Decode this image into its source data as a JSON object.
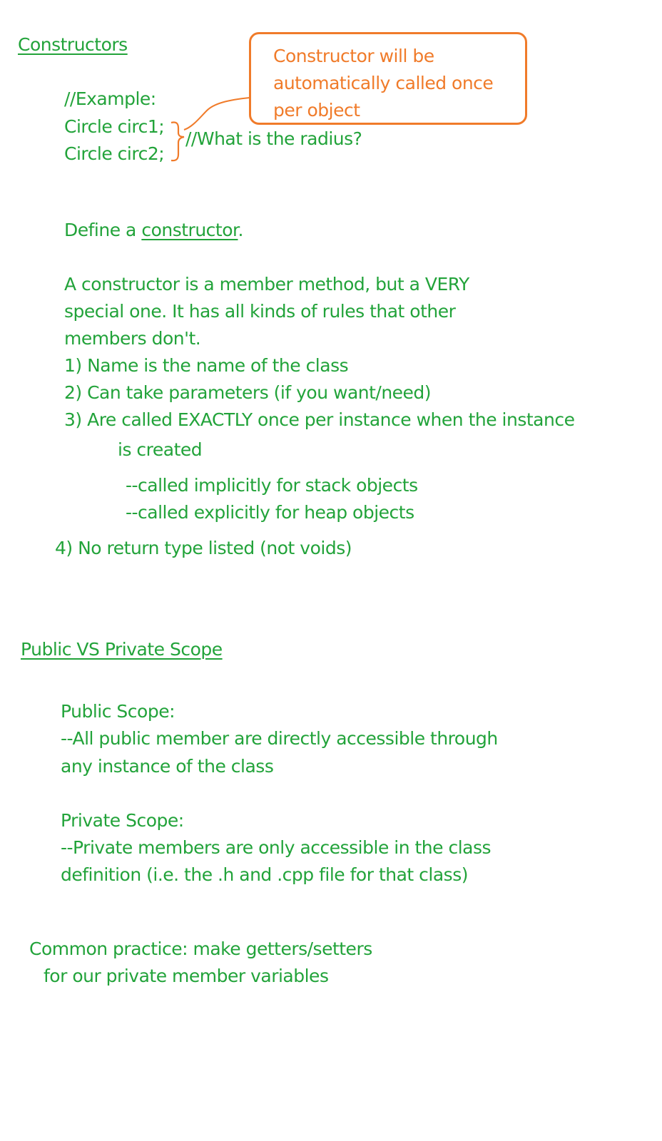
{
  "section1": {
    "heading": "Constructors",
    "example_comment": "//Example:",
    "code_line1": "Circle circ1;",
    "code_line2": "Circle circ2;",
    "radius_comment": "//What is the radius?",
    "callout_lines": [
      "Constructor will be",
      "automatically called once",
      "per object"
    ],
    "define_prefix": "Define a ",
    "define_link": "constructor",
    "define_suffix": ".",
    "para_lines": [
      "A constructor is a member method, but a VERY",
      "special one. It has all kinds of rules that other",
      "members don't."
    ],
    "rule1": "1) Name is the name of the class",
    "rule2": "2) Can take parameters (if you want/need)",
    "rule3_line1": "3) Are called EXACTLY once per instance when the instance",
    "rule3_line2": "is created",
    "sub1": "--called implicitly for stack objects",
    "sub2": "--called explicitly for heap objects",
    "rule4": "4) No return type listed (not voids)"
  },
  "section2": {
    "heading": "Public VS Private Scope",
    "public_title": "Public Scope:",
    "public_lines": [
      "--All public member are directly accessible through",
      "any instance of the class"
    ],
    "private_title": "Private Scope:",
    "private_lines": [
      "--Private members are only accessible in the class",
      "definition (i.e. the .h and .cpp file for that class)"
    ],
    "practice_lines": [
      "Common practice: make getters/setters",
      "for our private member variables"
    ]
  },
  "colors": {
    "text": "#22a33a",
    "annotation": "#f07b2a"
  }
}
